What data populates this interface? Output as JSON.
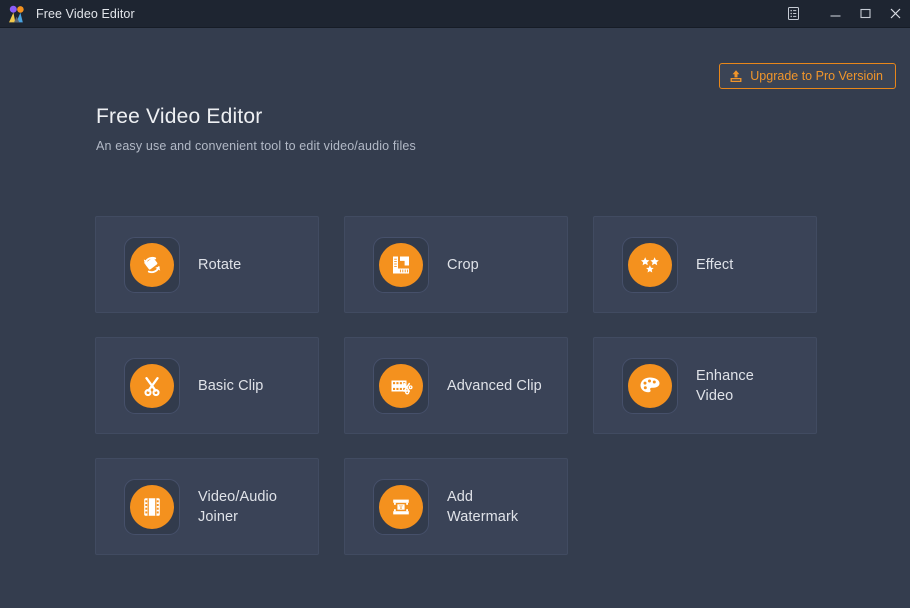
{
  "window": {
    "title": "Free Video Editor",
    "logo_icon": "app-logo-icon",
    "controls": {
      "menu_icon": "menu-list-icon",
      "minimize_icon": "minimize-icon",
      "maximize_icon": "maximize-icon",
      "close_icon": "close-icon"
    }
  },
  "header": {
    "title": "Free Video Editor",
    "subtitle": "An easy use and convenient tool to edit video/audio files",
    "upgrade_button": {
      "label": "Upgrade to Pro Versioin",
      "icon": "upload-icon"
    }
  },
  "colors": {
    "titlebar_bg": "#1e2531",
    "window_bg": "#343d4e",
    "tile_bg": "#3a4357",
    "tile_border": "#414b61",
    "icon_box_bg": "#323b4c",
    "accent_orange": "#f4911e",
    "upgrade_border": "#e8871a",
    "text_primary": "#dfe2e8",
    "text_secondary": "#b2b9c6"
  },
  "tiles": [
    {
      "label": "Rotate",
      "icon": "rotate-icon"
    },
    {
      "label": "Crop",
      "icon": "crop-icon"
    },
    {
      "label": "Effect",
      "icon": "effect-stars-icon"
    },
    {
      "label": "Basic Clip",
      "icon": "scissors-icon"
    },
    {
      "label": "Advanced Clip",
      "icon": "film-scissors-icon"
    },
    {
      "label": "Enhance\nVideo",
      "icon": "palette-icon"
    },
    {
      "label": "Video/Audio\nJoiner",
      "icon": "film-strip-icon"
    },
    {
      "label": "Add\nWatermark",
      "icon": "watermark-stamp-icon"
    }
  ]
}
